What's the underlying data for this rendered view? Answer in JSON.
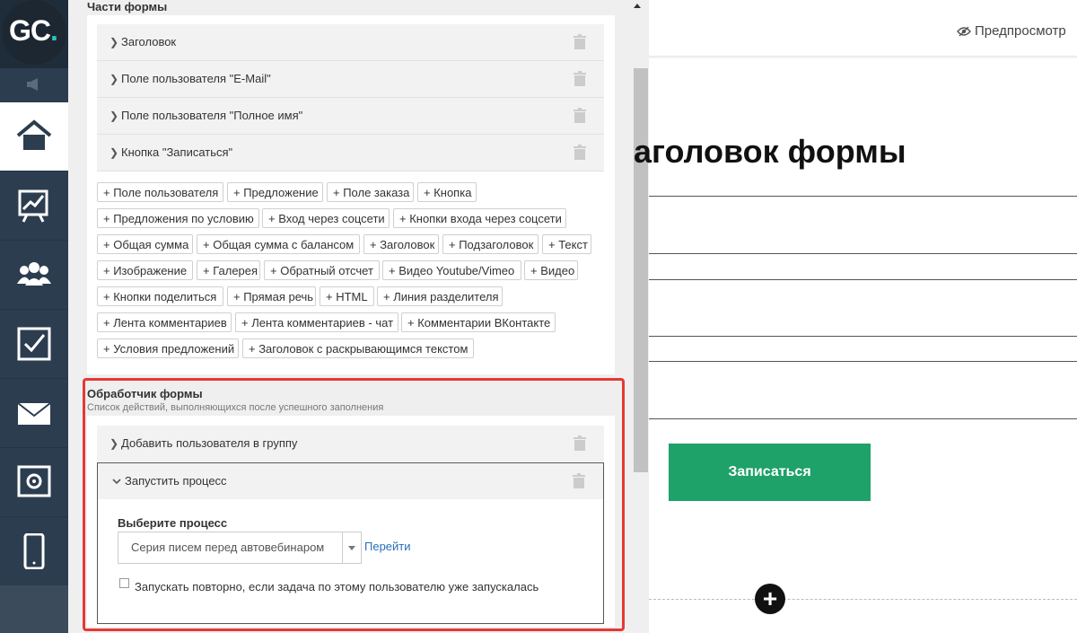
{
  "logo": {
    "text_main": "GC",
    "text_dot": "."
  },
  "panel": {
    "title": "Части формы"
  },
  "parts": [
    {
      "label": "Заголовок"
    },
    {
      "label": "Поле пользователя \"E-Mail\""
    },
    {
      "label": "Поле пользователя \"Полное имя\""
    },
    {
      "label": "Кнопка \"Записаться\""
    }
  ],
  "tags": [
    "+ Поле пользователя",
    "+ Предложение",
    "+ Поле заказа",
    "+ Кнопка",
    "+ Предложения по условию",
    "+ Вход через соцсети",
    "+ Кнопки входа через соцсети",
    "+ Общая сумма",
    "+ Общая сумма с балансом",
    "+ Заголовок",
    "+ Подзаголовок",
    "+ Текст",
    "+ Изображение",
    "+ Галерея",
    "+ Обратный отсчет",
    "+ Видео Youtube/Vimeo",
    "+ Видео",
    "+ Кнопки поделиться",
    "+ Прямая речь",
    "+ HTML",
    "+ Линия разделителя",
    "+ Лента комментариев",
    "+ Лента комментариев - чат",
    "+ Комментарии ВКонтакте",
    "+ Условия предложений",
    "+ Заголовок с раскрывающимся текстом"
  ],
  "handler": {
    "title": "Обработчик формы",
    "subtitle": "Список действий, выполняющихся после успешного заполнения",
    "actions": [
      {
        "label": "Добавить пользователя в группу"
      },
      {
        "label": "Запустить процесс"
      }
    ],
    "process_label": "Выберите процесс",
    "process_value": "Серия писем перед автовебинаром",
    "process_link": "Перейти",
    "repeat_label": "Запускать повторно, если задача по этому пользователю уже запускалась"
  },
  "preview": {
    "preview_label": "Предпросмотр",
    "heading": "аголовок формы",
    "submit_label": "Записаться",
    "add_label": "+"
  }
}
